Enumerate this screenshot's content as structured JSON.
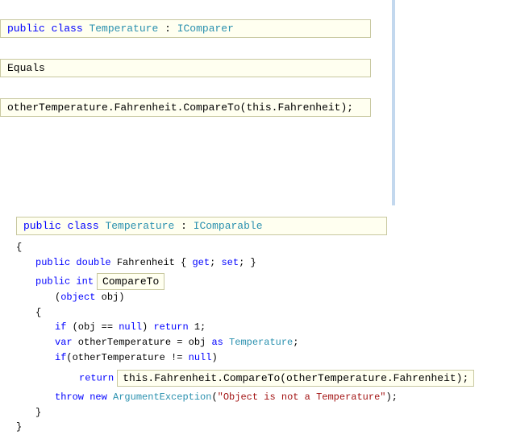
{
  "top": {
    "line1": {
      "kw1": "public",
      "kw2": "class",
      "typeName": "Temperature",
      "colon": " : ",
      "iface": "IComparer"
    },
    "equals": "Equals",
    "compare_line": "otherTemperature.Fahrenheit.CompareTo(this.Fahrenheit);"
  },
  "bottom": {
    "line1": {
      "kw1": "public",
      "kw2": "class",
      "typeName": "Temperature",
      "colon": " : ",
      "iface": "IComparable"
    },
    "open_brace": "{",
    "fahrenheit": {
      "kw1": "public",
      "kw2": "double",
      "name": " Fahrenheit { ",
      "get": "get",
      "sep": "; ",
      "set": "set",
      "end": "; }"
    },
    "compareTo": {
      "kw1": "public",
      "kw2": "int",
      "box": "CompareTo"
    },
    "param": {
      "open": "(",
      "kw": "object",
      "rest": " obj)"
    },
    "brace2": "{",
    "ifnull": {
      "kw1": "if",
      "rest1": " (obj == ",
      "kw2": "null",
      "rest2": ") ",
      "kw3": "return",
      "rest3": " 1;"
    },
    "varline": {
      "kw1": "var",
      "rest1": " otherTemperature = obj ",
      "kw2": "as",
      "sp": " ",
      "type": "Temperature",
      "rest2": ";"
    },
    "ifnotnull": {
      "kw1": "if",
      "rest1": "(otherTemperature != ",
      "kw2": "null",
      "rest2": ")"
    },
    "returnline": {
      "kw": "return",
      "box": "this.Fahrenheit.CompareTo(otherTemperature.Fahrenheit);"
    },
    "throwline": {
      "kw1": "throw",
      "kw2": "new",
      "sp": " ",
      "type": "ArgumentException",
      "paren": "(",
      "str": "\"Object is not a Temperature\"",
      "end": ");"
    },
    "brace3": "}",
    "brace4": "}"
  }
}
